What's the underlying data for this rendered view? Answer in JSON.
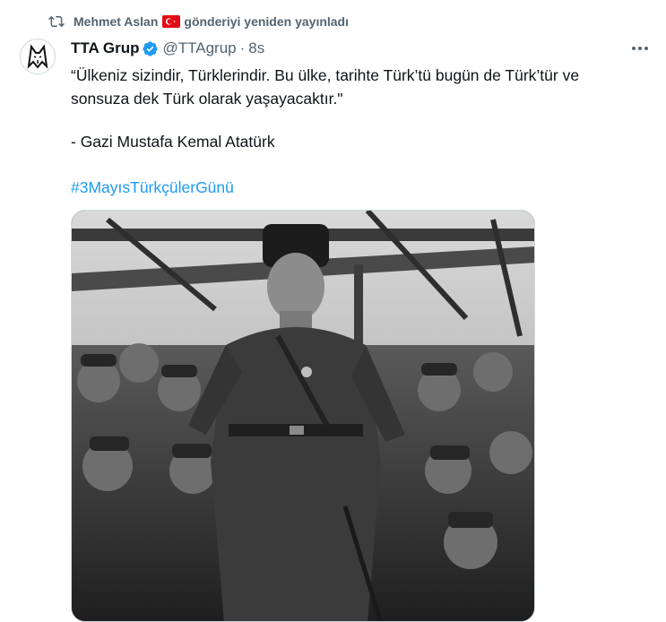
{
  "repost": {
    "user": "Mehmet Aslan",
    "action": "gönderiyi yeniden yayınladı",
    "icon": "repost-icon",
    "flag": "turkey-flag-icon"
  },
  "author": {
    "name": "TTA Grup",
    "handle": "@TTAgrup",
    "separator": "·",
    "time": "8s",
    "verified_color": "#1d9bf0"
  },
  "tweet": {
    "line1": "“Ülkeniz sizindir, Türklerindir. Bu ülke, tarihte Türk’tü bugün de Türk’tür ve",
    "line2": "sonsuza dek Türk olarak yaşayacaktır.\"",
    "attribution": "- Gazi Mustafa Kemal Atatürk",
    "hashtag": "#3MayısTürkçülerGünü"
  },
  "more_icon": "ellipsis-icon",
  "media": {
    "type": "black-and-white photograph"
  },
  "colors": {
    "link": "#1d9bf0",
    "secondary": "#536471",
    "text": "#0f1419"
  }
}
